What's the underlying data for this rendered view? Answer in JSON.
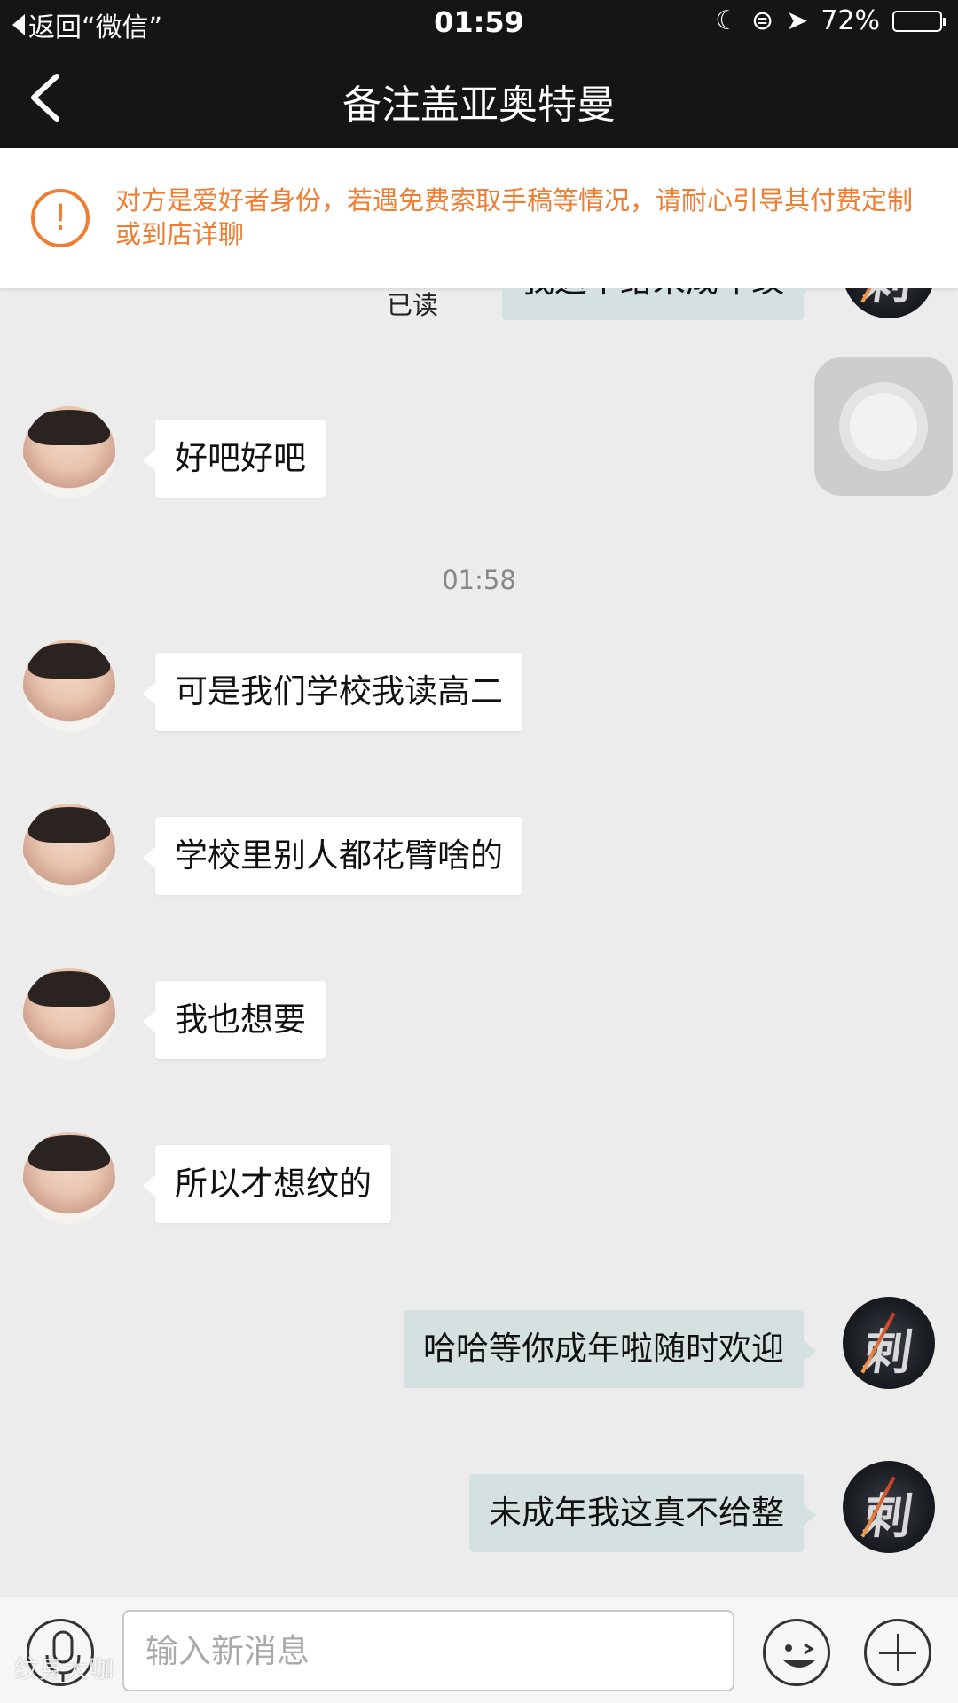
{
  "status_bar": {
    "back_app": "返回“微信”",
    "time": "01:59",
    "battery": "72%",
    "battery_level": 0.72
  },
  "nav": {
    "title": "备注盖亚奥特曼"
  },
  "notice": {
    "text": "对方是爱好者身份，若遇免费索取手稿等情况，请耐心引导其付费定制或到店详聊"
  },
  "messages": [
    {
      "side": "out",
      "text": "我这不给未成年纹",
      "read": "已读"
    },
    {
      "side": "in",
      "text": "好吧好吧"
    },
    {
      "side": "time",
      "text": "01:58"
    },
    {
      "side": "in",
      "text": "可是我们学校我读高二"
    },
    {
      "side": "in",
      "text": "学校里别人都花臂啥的"
    },
    {
      "side": "in",
      "text": "我也想要"
    },
    {
      "side": "in",
      "text": "所以才想纹的"
    },
    {
      "side": "out",
      "text": "哈哈等你成年啦随时欢迎"
    },
    {
      "side": "out",
      "text": "未成年我这真不给整"
    }
  ],
  "input": {
    "placeholder": "输入新消息"
  },
  "watermark": "纹身大咖",
  "colors": {
    "accent": "#ef7d32",
    "header_bg": "#151515",
    "out_bubble": "#d5e1e1",
    "chat_bg": "#ececec"
  }
}
